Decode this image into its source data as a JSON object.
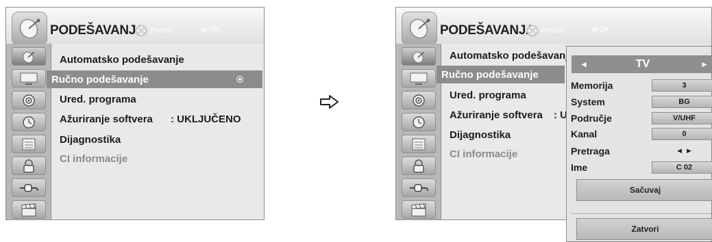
{
  "colors": {
    "panel_bg": "#e9e9e9",
    "sidebar_bg": "#b8b8b8",
    "selected_row": "#8c8c8c",
    "popup_bg": "#e4e4e4"
  },
  "left_menu": {
    "title": "PODEŠAVANJA",
    "nav_hint": "Pomeri",
    "ok_hint": "OK",
    "sidebar_icons": [
      "satellite-icon",
      "tv-icon",
      "speaker-icon",
      "clock-icon",
      "options-icon",
      "lock-icon",
      "plug-icon",
      "clapper-icon"
    ],
    "items": [
      {
        "label": "Automatsko podešavanje"
      },
      {
        "label": "Ručno podešavanje",
        "selected": true
      },
      {
        "label": "Ured. programa"
      },
      {
        "label": "Ažuriranje softvera",
        "value": ": UKLJUČENO"
      },
      {
        "label": "Dijagnostika"
      },
      {
        "label": "CI informacije",
        "disabled": true
      }
    ]
  },
  "right_menu": {
    "title": "PODEŠAVANJA",
    "nav_hint": "Pomeri",
    "ok_hint": "OK",
    "items": [
      {
        "label": "Automatsko podešavanje"
      },
      {
        "label": "Ručno podešavanje",
        "selected": true
      },
      {
        "label": "Ured. programa"
      },
      {
        "label": "Ažuriranje softvera",
        "value": ": U"
      },
      {
        "label": "Dijagnostika"
      },
      {
        "label": "CI informacije",
        "disabled": true
      }
    ]
  },
  "popup": {
    "source_label": "TV",
    "left_arrow": "◄",
    "right_arrow": "►",
    "fields": [
      {
        "label": "Memorija",
        "value": "3"
      },
      {
        "label": "System",
        "value": "BG"
      },
      {
        "label": "Područje",
        "value": "V/UHF"
      },
      {
        "label": "Kanal",
        "value": "0"
      },
      {
        "label": "Pretraga",
        "value": "◄ ►"
      },
      {
        "label": "Ime",
        "value": "C 02"
      }
    ],
    "save_label": "Sačuvaj",
    "close_label": "Zatvori"
  }
}
